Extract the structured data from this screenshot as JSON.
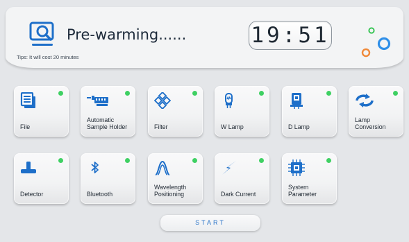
{
  "header": {
    "status_text": "Pre-warming......",
    "tip": "Tips: It will cost 20 minutes",
    "clock": "19:51",
    "status_icon": "monitor-search-icon",
    "decor_circle_colors": [
      "#3ec65a",
      "#f08a3a",
      "#2f8fe8"
    ]
  },
  "tiles": [
    {
      "label": "File",
      "icon": "file-stack-icon",
      "status_color": "#3fd063"
    },
    {
      "label": "Automatic\nSample Holder",
      "icon": "sample-holder-icon",
      "status_color": "#3fd063"
    },
    {
      "label": "Filter",
      "icon": "filter-diamond-icon",
      "status_color": "#3fd063"
    },
    {
      "label": "W Lamp",
      "icon": "w-lamp-icon",
      "status_color": "#3fd063"
    },
    {
      "label": "D Lamp",
      "icon": "d-lamp-icon",
      "status_color": "#3fd063"
    },
    {
      "label": "Lamp\nConversion",
      "icon": "lamp-conversion-icon",
      "status_color": "#3fd063"
    },
    {
      "label": "Detector",
      "icon": "detector-icon",
      "status_color": "#3fd063"
    },
    {
      "label": "Bluetooth",
      "icon": "bluetooth-icon",
      "status_color": "#3fd063"
    },
    {
      "label": "Wavelength\nPositioning",
      "icon": "wavelength-peak-icon",
      "status_color": "#3fd063"
    },
    {
      "label": "Dark Current",
      "icon": "lightning-icon",
      "status_color": "#3fd063"
    },
    {
      "label": "System\nParameter",
      "icon": "chip-icon",
      "status_color": "#3fd063"
    }
  ],
  "start_button": {
    "label": "START"
  },
  "colors": {
    "accent": "#1e6fc9",
    "status_ok": "#3fd063",
    "background": "#e4e6e9"
  }
}
